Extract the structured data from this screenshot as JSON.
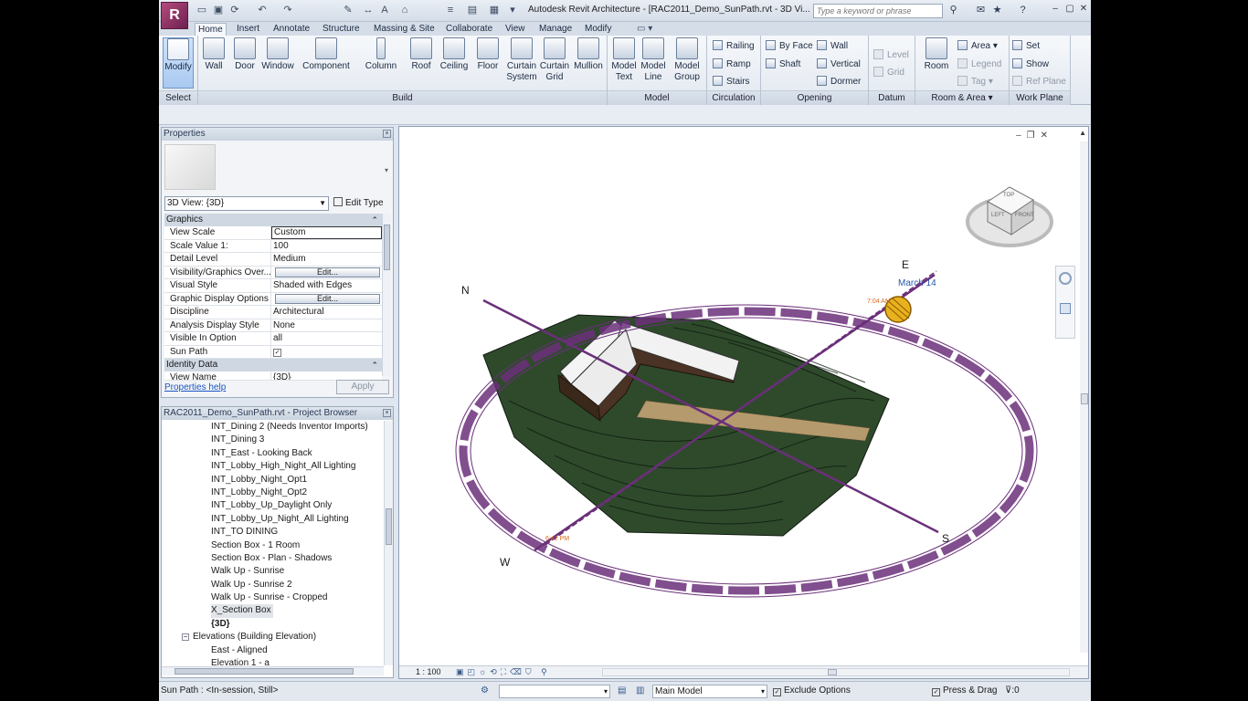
{
  "title_bar": {
    "app_logo": "R",
    "title": "Autodesk Revit Architecture - [RAC2011_Demo_SunPath.rvt - 3D Vi...",
    "search_placeholder": "Type a keyword or phrase"
  },
  "ribbon_tabs": [
    "Home",
    "Insert",
    "Annotate",
    "Structure",
    "Massing & Site",
    "Collaborate",
    "View",
    "Manage",
    "Modify"
  ],
  "ribbon": {
    "select": {
      "modify": "Modify",
      "panel": "Select"
    },
    "build": {
      "wall": "Wall",
      "door": "Door",
      "window": "Window",
      "component": "Component",
      "column": "Column",
      "roof": "Roof",
      "ceiling": "Ceiling",
      "floor": "Floor",
      "curtain_system_1": "Curtain",
      "curtain_system_2": "System",
      "curtain_grid_1": "Curtain",
      "curtain_grid_2": "Grid",
      "mullion": "Mullion",
      "panel": "Build"
    },
    "model": {
      "model_text_1": "Model",
      "model_text_2": "Text",
      "model_line_1": "Model",
      "model_line_2": "Line",
      "model_group_1": "Model",
      "model_group_2": "Group",
      "panel": "Model"
    },
    "circulation": {
      "railing": "Railing",
      "ramp": "Ramp",
      "stairs": "Stairs",
      "panel": "Circulation"
    },
    "opening": {
      "by_face": "By Face",
      "shaft": "Shaft",
      "wall": "Wall",
      "vertical": "Vertical",
      "dormer": "Dormer",
      "panel": "Opening"
    },
    "datum": {
      "level": "Level",
      "grid": "Grid",
      "panel": "Datum"
    },
    "room_area": {
      "room": "Room",
      "area": "Area",
      "legend": "Legend",
      "tag": "Tag",
      "panel": "Room & Area"
    },
    "work_plane": {
      "set": "Set",
      "show": "Show",
      "ref_plane": "Ref Plane",
      "panel": "Work Plane"
    }
  },
  "properties": {
    "title": "Properties",
    "type_selector": "3D View: {3D}",
    "edit_type": "Edit Type",
    "groups": {
      "graphics": "Graphics",
      "identity": "Identity Data"
    },
    "rows": [
      {
        "name": "View Scale",
        "value": "Custom"
      },
      {
        "name": "Scale Value    1:",
        "value": "100"
      },
      {
        "name": "Detail Level",
        "value": "Medium"
      },
      {
        "name": "Visibility/Graphics Over...",
        "value": "Edit..."
      },
      {
        "name": "Visual Style",
        "value": "Shaded with Edges"
      },
      {
        "name": "Graphic Display Options",
        "value": "Edit..."
      },
      {
        "name": "Discipline",
        "value": "Architectural"
      },
      {
        "name": "Analysis Display Style",
        "value": "None"
      },
      {
        "name": "Visible In Option",
        "value": "all"
      },
      {
        "name": "Sun Path",
        "value": "✓"
      }
    ],
    "identity_rows": [
      {
        "name": "View Name",
        "value": "{3D}"
      }
    ],
    "help_link": "Properties help",
    "apply": "Apply"
  },
  "project_browser": {
    "title": "RAC2011_Demo_SunPath.rvt - Project Browser",
    "items": [
      "INT_Dining 2 (Needs Inventor Imports)",
      "INT_Dining 3",
      "INT_East - Looking Back",
      "INT_Lobby_High_Night_All Lighting",
      "INT_Lobby_Night_Opt1",
      "INT_Lobby_Night_Opt2",
      "INT_Lobby_Up_Daylight Only",
      "INT_Lobby_Up_Night_All Lighting",
      "INT_TO DINING",
      "Section Box - 1 Room",
      "Section Box - Plan - Shadows",
      "Walk Up - Sunrise",
      "Walk Up - Sunrise 2",
      "Walk Up - Sunrise - Cropped",
      "X_Section Box",
      "{3D}"
    ],
    "elevations_group": "Elevations (Building Elevation)",
    "elevation_items": [
      "East - Aligned",
      "Elevation 1 - a"
    ]
  },
  "view": {
    "compass": {
      "n": "N",
      "e": "E",
      "s": "S",
      "w": "W"
    },
    "sun_label": "March 14",
    "sun_time": "7:04 AM",
    "sunset_time": "6:42 PM",
    "view_cube": {
      "top": "TOP",
      "left": "LEFT",
      "front": "FRONT"
    },
    "scale": "1 : 100",
    "colors": {
      "sun_path": "#6b2f7a",
      "terrain": "#2f4a2c",
      "sun": "#e8b21f"
    }
  },
  "status_bar": {
    "message": "Sun Path : <In-session, Still>",
    "workset": "Main Model",
    "exclude_options": "Exclude Options",
    "press_drag": "Press & Drag",
    "filter_count": ":0"
  }
}
